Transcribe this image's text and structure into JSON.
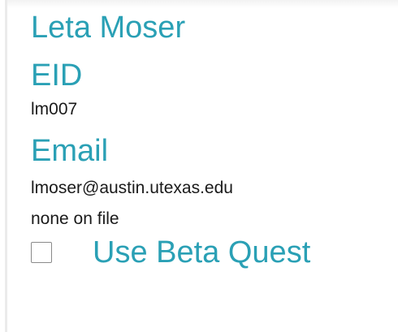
{
  "profile": {
    "name": "Leta Moser",
    "eid_label": "EID",
    "eid_value": "lm007",
    "email_label": "Email",
    "email_value": "lmoser@austin.utexas.edu",
    "alt_contact_value": "none on file"
  },
  "beta": {
    "label": "Use Beta Quest",
    "checked": false
  },
  "colors": {
    "accent": "#2aa0b5",
    "text": "#1a1a1a"
  }
}
